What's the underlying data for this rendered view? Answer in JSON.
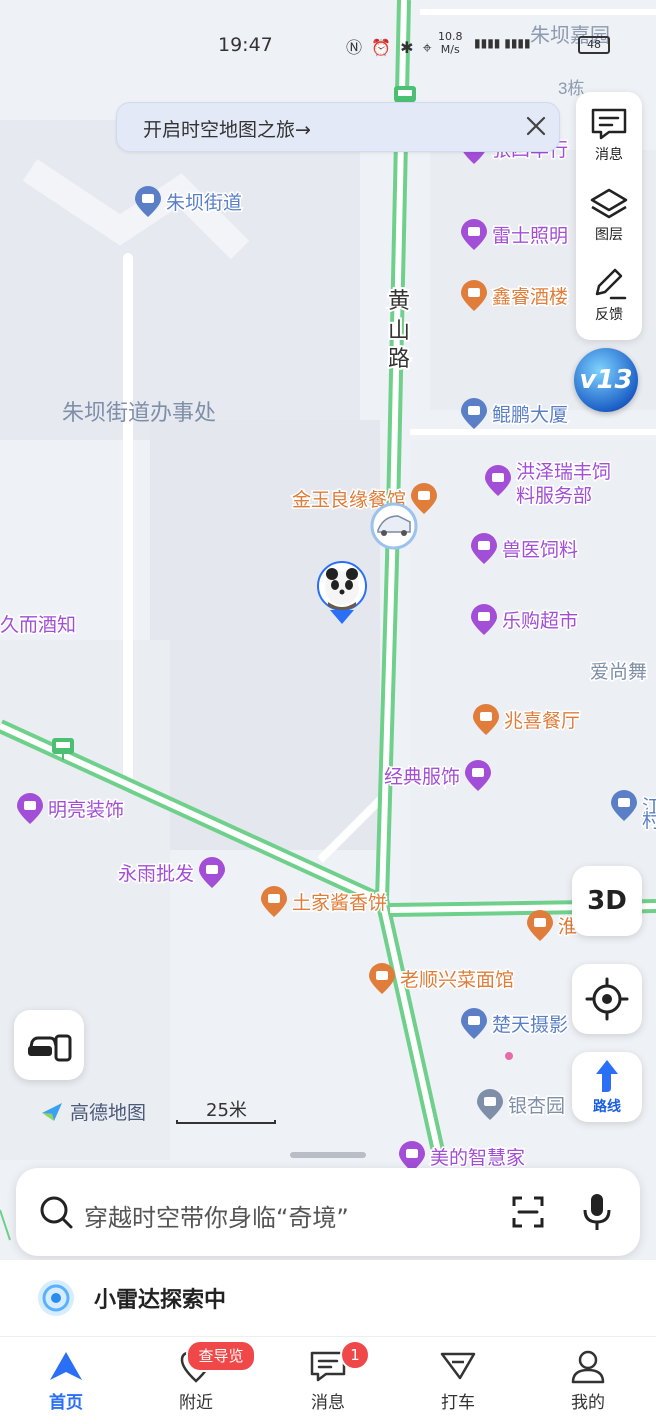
{
  "status_bar": {
    "time": "19:47",
    "speed": "10.8",
    "speed_unit": "M/s",
    "battery": "48"
  },
  "banner": {
    "text": "开启时空地图之旅→"
  },
  "tools": [
    {
      "label": "消息",
      "icon": "message-icon"
    },
    {
      "label": "图层",
      "icon": "layers-icon"
    },
    {
      "label": "反馈",
      "icon": "feedback-icon"
    }
  ],
  "badge_v13": "v13",
  "map": {
    "roads": [
      {
        "name": "黄山路"
      }
    ],
    "areas": [
      {
        "name": "朱坝街道办事处"
      },
      {
        "name": "朱坝嘉园"
      },
      {
        "name": "3栋"
      }
    ],
    "pois": [
      {
        "name": "朱坝街道",
        "kind": "gov"
      },
      {
        "name": "张四羊行",
        "kind": "shop"
      },
      {
        "name": "雷士照明",
        "kind": "shop"
      },
      {
        "name": "鑫睿酒楼",
        "kind": "food"
      },
      {
        "name": "鲲鹏大厦",
        "kind": "building"
      },
      {
        "name": "洪泽瑞丰饲料服务部",
        "kind": "shop"
      },
      {
        "name": "金玉良缘餐馆",
        "kind": "food"
      },
      {
        "name": "兽医饲料",
        "kind": "shop"
      },
      {
        "name": "乐购超市",
        "kind": "shop"
      },
      {
        "name": "久而酒知",
        "kind": "shop"
      },
      {
        "name": "爱尚舞",
        "kind": "area"
      },
      {
        "name": "兆喜餐厅",
        "kind": "food"
      },
      {
        "name": "经典服饰",
        "kind": "shop"
      },
      {
        "name": "明亮装饰",
        "kind": "shop"
      },
      {
        "name": "永雨批发",
        "kind": "shop"
      },
      {
        "name": "土家酱香饼",
        "kind": "food"
      },
      {
        "name": "淮",
        "kind": "food"
      },
      {
        "name": "老顺兴菜面馆",
        "kind": "food"
      },
      {
        "name": "楚天摄影",
        "kind": "building"
      },
      {
        "name": "银杏园",
        "kind": "area"
      },
      {
        "name": "美的智慧家",
        "kind": "shop"
      },
      {
        "name": "江",
        "kind": "building"
      },
      {
        "name": "村",
        "kind": "building"
      }
    ]
  },
  "controls": {
    "three_d": "3D",
    "route": "路线"
  },
  "brand": {
    "logo_text": "高德地图",
    "scale": "25米"
  },
  "search": {
    "placeholder": "穿越时空带你身临“奇境”"
  },
  "radar": {
    "text": "小雷达探索中"
  },
  "tabs": [
    {
      "label": "首页",
      "active": true
    },
    {
      "label": "附近",
      "badge": "查导览"
    },
    {
      "label": "消息",
      "badge": "1"
    },
    {
      "label": "打车"
    },
    {
      "label": "我的"
    }
  ],
  "colors": {
    "road_green": "#6fd08c",
    "accent_blue": "#2a6ff6",
    "poi_purple": "#a24ed6",
    "poi_orange": "#e07d3a",
    "poi_blue": "#5b7fc7"
  }
}
